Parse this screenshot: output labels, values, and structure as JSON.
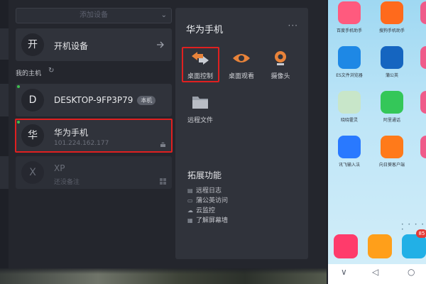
{
  "app": {
    "add_device_label": "添加设备",
    "power_on_label": "开机设备",
    "power_on_avatar": "开",
    "my_hosts_label": "我的主机",
    "devices": [
      {
        "avatar": "D",
        "name": "DESKTOP-9FP3P79",
        "badge": "本机",
        "online": true
      },
      {
        "avatar": "华",
        "name": "华为手机",
        "ip": "101.224.162.177",
        "online": true
      },
      {
        "avatar": "X",
        "name": "XP",
        "note": "还没备注",
        "online": false
      }
    ],
    "panel": {
      "title": "华为手机",
      "more": "···",
      "functions": [
        {
          "label": "桌面控制",
          "icon": "remote-desktop-icon"
        },
        {
          "label": "桌面观看",
          "icon": "eye-icon"
        },
        {
          "label": "摄像头",
          "icon": "camera-icon"
        },
        {
          "label": "远程文件",
          "icon": "folder-icon"
        }
      ],
      "ext_title": "拓展功能",
      "ext_items": [
        {
          "label": "远程日志",
          "icon": "log-icon"
        },
        {
          "label": "蒲公英访问",
          "icon": "document-icon"
        },
        {
          "label": "云监控",
          "icon": "cloud-icon"
        },
        {
          "label": "了解屏幕墙",
          "icon": "grid-icon"
        }
      ]
    },
    "colors": {
      "highlight": "#e02020",
      "online": "#3fbf4f",
      "bg": "#24262d",
      "card": "#30333b"
    }
  },
  "phone": {
    "apps": [
      {
        "label": "百度手机助手",
        "color": "#ff5a7e"
      },
      {
        "label": "搜狗手机助手",
        "color": "#ff6a1c"
      },
      {
        "label": "ES文件浏览器",
        "color": "#1e88e5"
      },
      {
        "label": "蒲公英",
        "color": "#1565c0"
      },
      {
        "label": "晓晓霍灵",
        "color": "#c8e6c9"
      },
      {
        "label": "阿里通话",
        "color": "#34c759"
      },
      {
        "label": "讯飞输入法",
        "color": "#2979ff"
      },
      {
        "label": "向日葵客户端",
        "color": "#ff7a1a"
      }
    ],
    "dock": [
      {
        "color": "#ff3b6b"
      },
      {
        "color": "#ff9f1a"
      },
      {
        "color": "#22b0e6"
      }
    ],
    "dock_badge": "85",
    "nav": [
      "∨",
      "◁",
      "○"
    ]
  }
}
